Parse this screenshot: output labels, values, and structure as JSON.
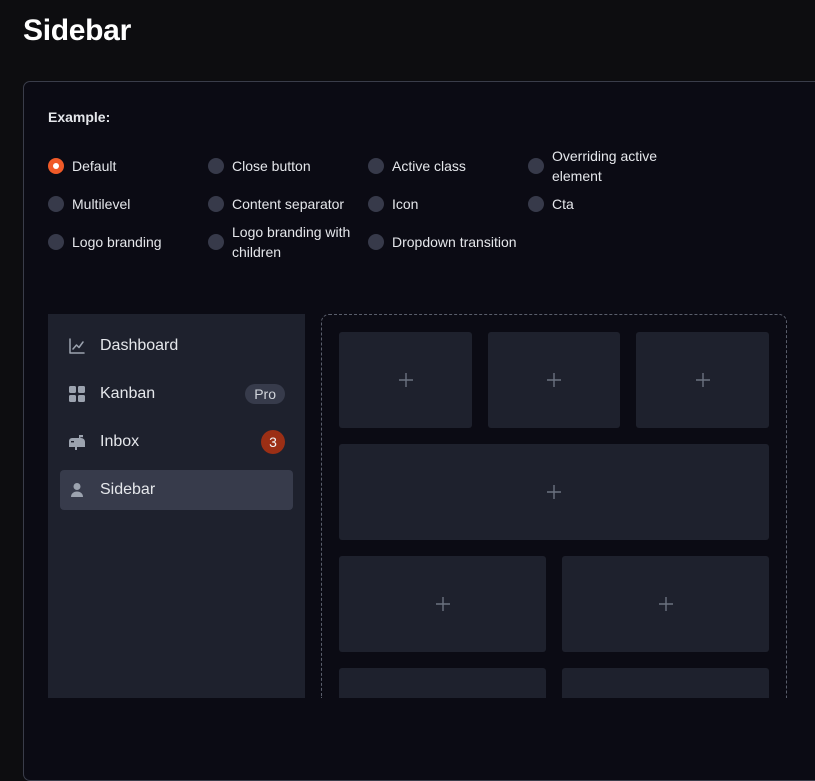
{
  "page": {
    "title": "Sidebar"
  },
  "example": {
    "label": "Example:",
    "options": [
      {
        "label": "Default",
        "checked": true
      },
      {
        "label": "Close button",
        "checked": false
      },
      {
        "label": "Active class",
        "checked": false
      },
      {
        "label": "Overriding active element",
        "checked": false
      },
      {
        "label": "Multilevel",
        "checked": false
      },
      {
        "label": "Content separator",
        "checked": false
      },
      {
        "label": "Icon",
        "checked": false
      },
      {
        "label": "Cta",
        "checked": false
      },
      {
        "label": "Logo branding",
        "checked": false
      },
      {
        "label": "Logo branding with children",
        "checked": false
      },
      {
        "label": "Dropdown transition",
        "checked": false
      }
    ]
  },
  "sidebar": {
    "items": [
      {
        "label": "Dashboard",
        "icon": "chart-line-icon",
        "active": false
      },
      {
        "label": "Kanban",
        "icon": "grid-icon",
        "badge": "Pro",
        "active": false
      },
      {
        "label": "Inbox",
        "icon": "inbox-icon",
        "count": "3",
        "active": false
      },
      {
        "label": "Sidebar",
        "icon": "user-icon",
        "active": true
      }
    ]
  },
  "colors": {
    "accent": "#f05a28",
    "count_badge": "#9b2f15",
    "panel_bg": "#1e212d",
    "active_item": "#373b4b"
  }
}
